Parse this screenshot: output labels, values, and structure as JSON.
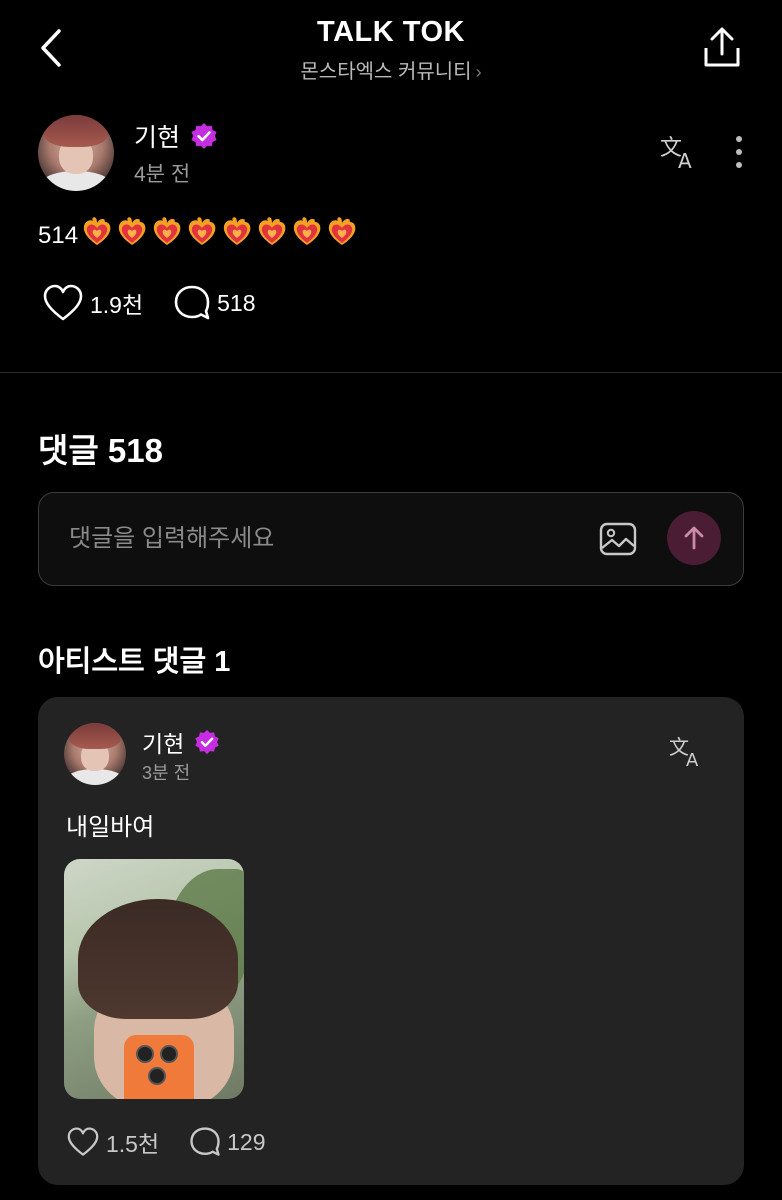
{
  "header": {
    "title": "TALK TOK",
    "subtitle": "몬스타엑스 커뮤니티",
    "subtitle_chevron": "›"
  },
  "post": {
    "author": "기현",
    "time": "4분 전",
    "text": "514",
    "emoji_count": 8,
    "likes": "1.9천",
    "comments": "518"
  },
  "comments_section": {
    "heading": "댓글 518",
    "input_placeholder": "댓글을 입력해주세요"
  },
  "artist_comments": {
    "heading": "아티스트 댓글 1",
    "comment": {
      "author": "기현",
      "time": "3분 전",
      "text": "내일바여",
      "likes": "1.5천",
      "replies": "129"
    }
  },
  "colors": {
    "background": "#000000",
    "card": "#232323",
    "verified": "#c42ee0",
    "send_button": "#4b1d34",
    "muted_text": "#9a9a9a"
  },
  "icons": [
    "back-arrow-icon",
    "share-icon",
    "verified-icon",
    "translate-icon",
    "more-vertical-icon",
    "heart-icon",
    "comment-bubble-icon",
    "image-icon",
    "send-arrow-icon",
    "fire-heart-emoji"
  ]
}
